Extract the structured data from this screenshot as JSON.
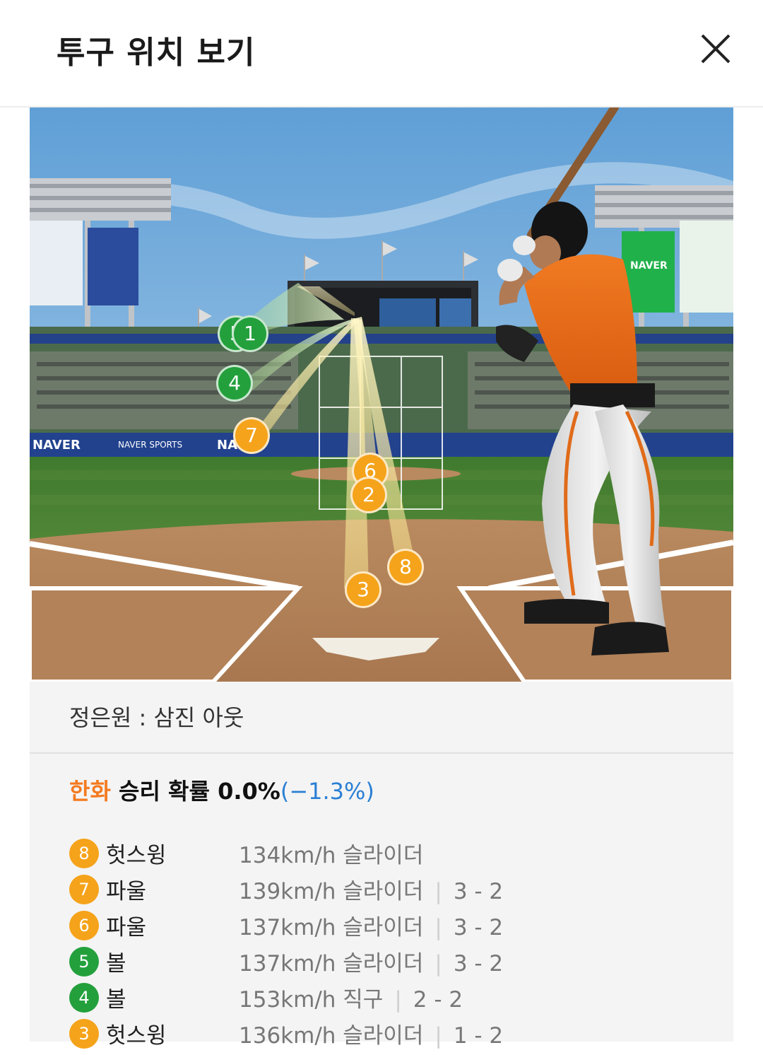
{
  "header": {
    "title": "투구 위치 보기"
  },
  "scene": {
    "pitch_markers": [
      {
        "label": "5"
      },
      {
        "label": "1"
      },
      {
        "label": "4"
      },
      {
        "label": "7"
      },
      {
        "label": "6"
      },
      {
        "label": "2"
      },
      {
        "label": "8"
      },
      {
        "label": "3"
      }
    ],
    "ad_text": {
      "naver_left": "NAVER",
      "naver_sports": "NAVER SPORTS",
      "naver_right": "NAVER",
      "naver_mid": "NA"
    }
  },
  "result": {
    "text": "정은원 : 삼진 아웃"
  },
  "win_probability": {
    "team": "한화",
    "label": " 승리 확률 0.0%",
    "delta": "(−1.3%)"
  },
  "pitches": [
    {
      "num": "8",
      "color": "#f5a31a",
      "outcome": "헛스윙",
      "speed": "134km/h",
      "pitch": "슬라이더",
      "count": ""
    },
    {
      "num": "7",
      "color": "#f5a31a",
      "outcome": "파울",
      "speed": "139km/h",
      "pitch": "슬라이더",
      "count": "3 - 2"
    },
    {
      "num": "6",
      "color": "#f5a31a",
      "outcome": "파울",
      "speed": "137km/h",
      "pitch": "슬라이더",
      "count": "3 - 2"
    },
    {
      "num": "5",
      "color": "#23a03c",
      "outcome": "볼",
      "speed": "137km/h",
      "pitch": "슬라이더",
      "count": "3 - 2"
    },
    {
      "num": "4",
      "color": "#23a03c",
      "outcome": "볼",
      "speed": "153km/h",
      "pitch": "직구",
      "count": "2 - 2"
    },
    {
      "num": "3",
      "color": "#f5a31a",
      "outcome": "헛스윙",
      "speed": "136km/h",
      "pitch": "슬라이더",
      "count": "1 - 2"
    }
  ]
}
